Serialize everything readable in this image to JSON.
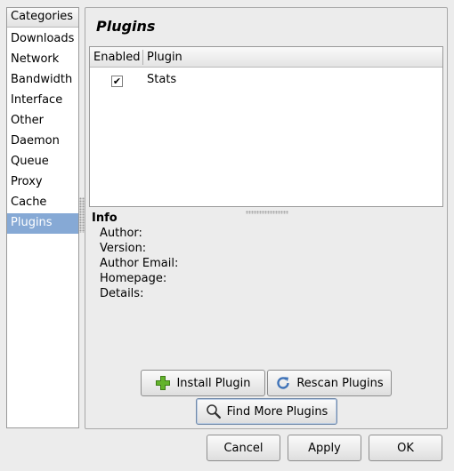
{
  "categories": {
    "header": "Categories",
    "items": [
      "Downloads",
      "Network",
      "Bandwidth",
      "Interface",
      "Other",
      "Daemon",
      "Queue",
      "Proxy",
      "Cache",
      "Plugins"
    ],
    "selected": "Plugins"
  },
  "plugins_page": {
    "title": "Plugins",
    "table": {
      "columns": [
        "Enabled",
        "Plugin"
      ],
      "rows": [
        {
          "enabled": true,
          "enabled_glyph": "✔",
          "name": "Stats"
        }
      ]
    },
    "info": {
      "title": "Info",
      "fields": [
        "Author:",
        "Version:",
        "Author Email:",
        "Homepage:",
        "Details:"
      ]
    },
    "buttons": {
      "install": "Install Plugin",
      "rescan": "Rescan Plugins",
      "find_more": "Find More Plugins"
    }
  },
  "dialog_buttons": {
    "cancel": "Cancel",
    "apply": "Apply",
    "ok": "OK"
  },
  "colors": {
    "selection": "#86a9d5",
    "install_icon": "#63b32c",
    "rescan_icon": "#3f73b8"
  }
}
